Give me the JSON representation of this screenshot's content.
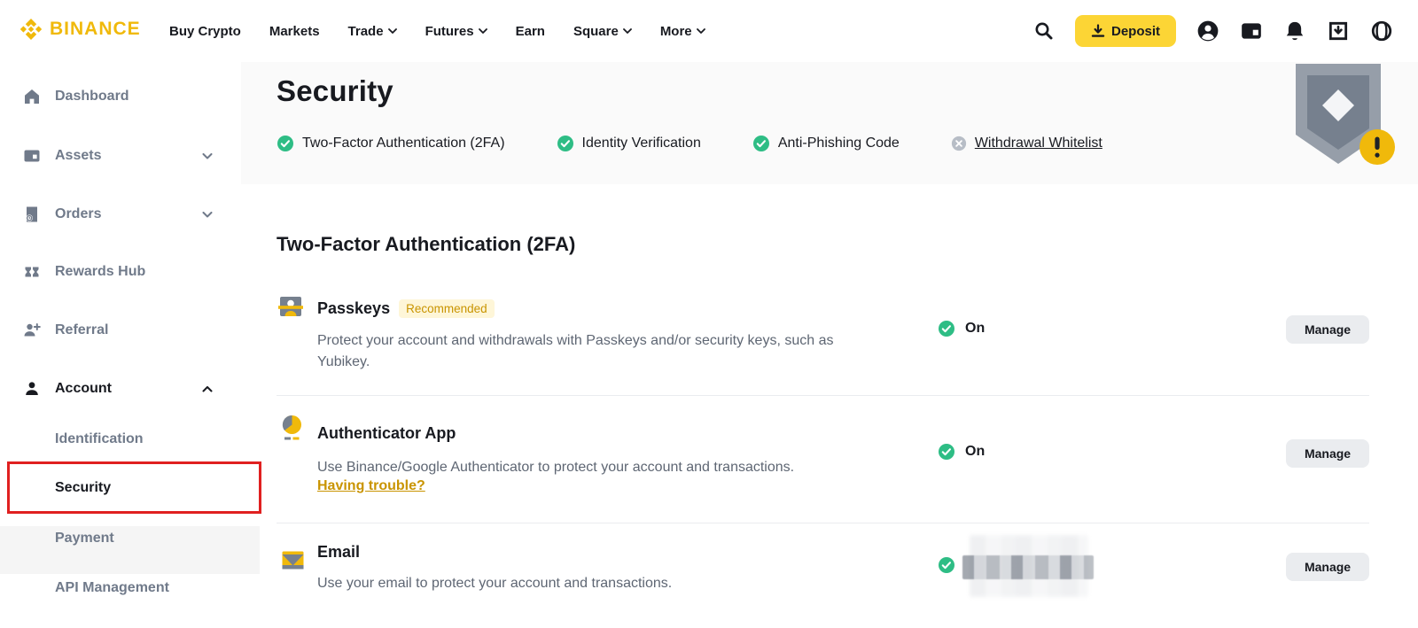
{
  "brand": {
    "name": "BINANCE",
    "color": "#F0B90B"
  },
  "navbar": {
    "links": [
      {
        "label": "Buy Crypto",
        "dropdown": false
      },
      {
        "label": "Markets",
        "dropdown": false
      },
      {
        "label": "Trade",
        "dropdown": true
      },
      {
        "label": "Futures",
        "dropdown": true
      },
      {
        "label": "Earn",
        "dropdown": false
      },
      {
        "label": "Square",
        "dropdown": true
      },
      {
        "label": "More",
        "dropdown": true
      }
    ],
    "deposit_label": "Deposit",
    "right_icons": [
      "search-icon",
      "profile-icon",
      "wallet-icon",
      "notification-bell-icon",
      "desktop-download-icon",
      "language-globe-icon"
    ]
  },
  "sidebar": {
    "items": [
      {
        "label": "Dashboard",
        "icon": "home-icon",
        "chevron": null,
        "active": false
      },
      {
        "label": "Assets",
        "icon": "wallet-icon",
        "chevron": "down",
        "active": false
      },
      {
        "label": "Orders",
        "icon": "orders-icon",
        "chevron": "down",
        "active": false
      },
      {
        "label": "Rewards Hub",
        "icon": "rewards-icon",
        "chevron": null,
        "active": false
      },
      {
        "label": "Referral",
        "icon": "referral-icon",
        "chevron": null,
        "active": false
      },
      {
        "label": "Account",
        "icon": "account-icon",
        "chevron": "up",
        "active": true,
        "expanded": true
      }
    ],
    "account_children": [
      {
        "label": "Identification",
        "active": false
      },
      {
        "label": "Security",
        "active": true,
        "annotated": true
      },
      {
        "label": "Payment",
        "active": false
      },
      {
        "label": "API Management",
        "active": false
      }
    ]
  },
  "page": {
    "title": "Security",
    "status_items": [
      {
        "label": "Two-Factor Authentication (2FA)",
        "state": "ok"
      },
      {
        "label": "Identity Verification",
        "state": "ok"
      },
      {
        "label": "Anti-Phishing Code",
        "state": "ok"
      },
      {
        "label": "Withdrawal Whitelist",
        "state": "off",
        "link": true
      }
    ],
    "section_title": "Two-Factor Authentication (2FA)",
    "rows": [
      {
        "icon": "passkeys-icon",
        "title": "Passkeys",
        "badge": "Recommended",
        "description": "Protect your account and withdrawals with Passkeys and/or security keys, such as Yubikey.",
        "status": "On",
        "action": "Manage"
      },
      {
        "icon": "authenticator-app-icon",
        "title": "Authenticator App",
        "description": "Use Binance/Google Authenticator to protect your account and transactions.",
        "link": "Having trouble?",
        "status": "On",
        "action": "Manage"
      },
      {
        "icon": "email-icon",
        "title": "Email",
        "description": "Use your email to protect your account and transactions.",
        "status_redacted": true,
        "action": "Manage"
      }
    ]
  },
  "colors": {
    "brand_yellow": "#F0B90B",
    "deposit_yellow": "#FCD535",
    "success_green": "#2EBD85",
    "inactive_gray": "#B7BDC6",
    "text_dark": "#181A20",
    "text_gray": "#707A8A",
    "annotation_red": "#E02020",
    "badge_bg": "#FEF6D8",
    "badge_text": "#C99400"
  }
}
